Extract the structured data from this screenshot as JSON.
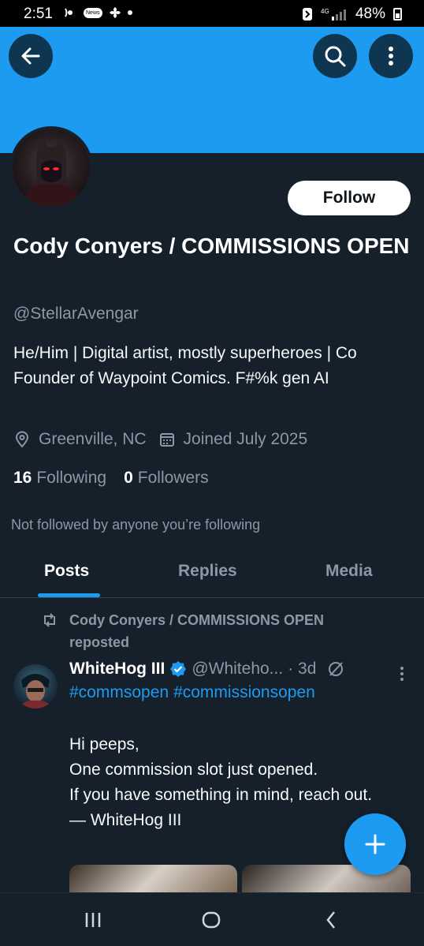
{
  "status_bar": {
    "time": "2:51",
    "battery": "48%",
    "small_label": "News"
  },
  "header": {
    "back_icon": "arrow-left-icon",
    "search_icon": "search-icon",
    "more_icon": "more-vertical-icon",
    "banner_color": "#1d9bf0"
  },
  "profile": {
    "follow_label": "Follow",
    "name": "Cody Conyers / COMMISSIONS OPEN",
    "handle": "@StellarAvengar",
    "bio": "He/Him | Digital artist, mostly superheroes | Co Founder of Waypoint Comics. F#%k gen AI",
    "location": "Greenville, NC",
    "joined": "Joined July 2025",
    "following_count": "16",
    "following_label": "Following",
    "followers_count": "0",
    "followers_label": "Followers",
    "not_followed": "Not followed by anyone you’re following"
  },
  "tabs": [
    {
      "label": "Posts",
      "active": true
    },
    {
      "label": "Replies",
      "active": false
    },
    {
      "label": "Media",
      "active": false
    }
  ],
  "post": {
    "repost_text": "Cody Conyers / COMMISSIONS OPEN reposted",
    "author": "WhiteHog III",
    "handle": "@Whiteho...",
    "time": "· 3d",
    "hashtags": [
      "#commsopen",
      "#commissionsopen"
    ],
    "body": [
      "Hi peeps,",
      "One commission slot just opened.",
      "If you have something in mind, reach out.",
      "— WhiteHog III"
    ]
  },
  "colors": {
    "accent": "#1d9bf0",
    "background": "#15202b",
    "secondary_text": "#8b98a5"
  }
}
